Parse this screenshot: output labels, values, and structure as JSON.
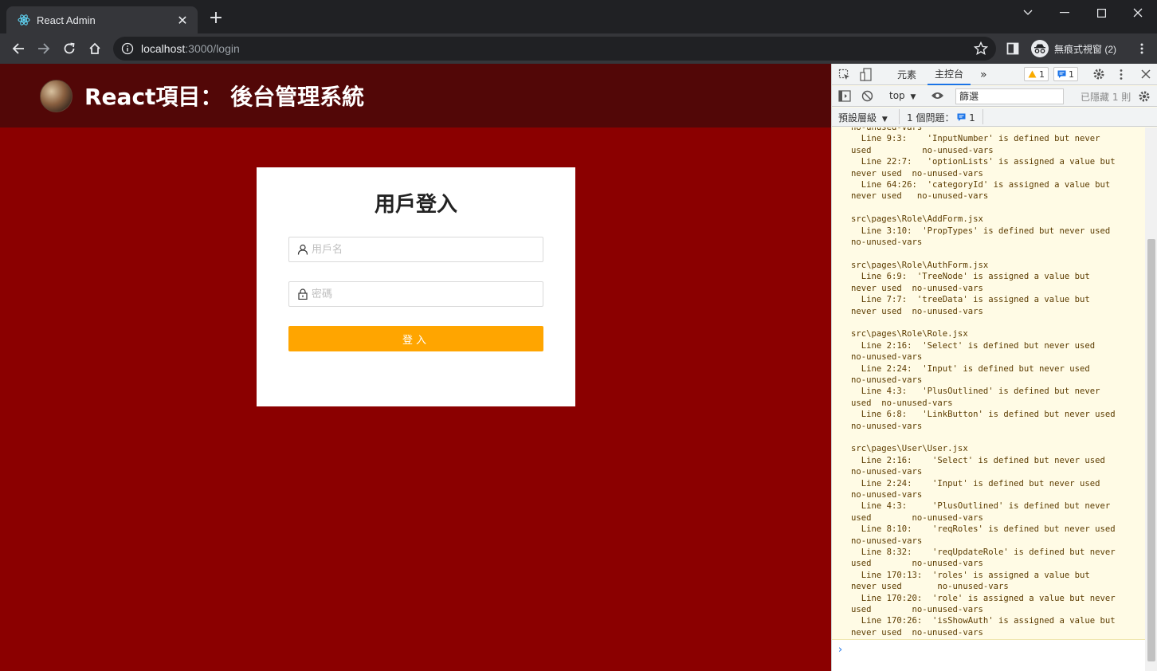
{
  "browser": {
    "tab_title": "React Admin",
    "url_host": "localhost",
    "url_path": ":3000/login",
    "incognito_label": "無痕式視窗 (2)"
  },
  "page": {
    "header_title": "React項目： 後台管理系統",
    "login": {
      "title": "用戶登入",
      "username_placeholder": "用戶名",
      "password_placeholder": "密碼",
      "submit_label": "登入"
    },
    "colors": {
      "background": "#8b0000",
      "header": "#520707",
      "button": "#ffa500"
    }
  },
  "devtools": {
    "tabs": [
      "元素",
      "主控台"
    ],
    "more_tabs": "»",
    "warning_count": "1",
    "message_count": "1",
    "context": "top",
    "filter_value": "篩選",
    "hidden_label": "已隱藏 1 則",
    "levels_label": "預設層級",
    "issues_label": "1 個問題：",
    "issues_count": "1",
    "console_text": "no-unused-vars\n  Line 9:3:    'InputNumber' is defined but never\nused          no-unused-vars\n  Line 22:7:   'optionLists' is assigned a value but\nnever used  no-unused-vars\n  Line 64:26:  'categoryId' is assigned a value but\nnever used   no-unused-vars\n\nsrc\\pages\\Role\\AddForm.jsx\n  Line 3:10:  'PropTypes' is defined but never used\nno-unused-vars\n\nsrc\\pages\\Role\\AuthForm.jsx\n  Line 6:9:  'TreeNode' is assigned a value but\nnever used  no-unused-vars\n  Line 7:7:  'treeData' is assigned a value but\nnever used  no-unused-vars\n\nsrc\\pages\\Role\\Role.jsx\n  Line 2:16:  'Select' is defined but never used\nno-unused-vars\n  Line 2:24:  'Input' is defined but never used\nno-unused-vars\n  Line 4:3:   'PlusOutlined' is defined but never\nused  no-unused-vars\n  Line 6:8:   'LinkButton' is defined but never used\nno-unused-vars\n\nsrc\\pages\\User\\User.jsx\n  Line 2:16:    'Select' is defined but never used\nno-unused-vars\n  Line 2:24:    'Input' is defined but never used\nno-unused-vars\n  Line 4:3:     'PlusOutlined' is defined but never\nused        no-unused-vars\n  Line 8:10:    'reqRoles' is defined but never used\nno-unused-vars\n  Line 8:32:    'reqUpdateRole' is defined but never\nused        no-unused-vars\n  Line 170:13:  'roles' is assigned a value but\nnever used       no-unused-vars\n  Line 170:20:  'role' is assigned a value but never\nused        no-unused-vars\n  Line 170:26:  'isShowAuth' is assigned a value but\nnever used  no-unused-vars",
    "prompt_symbol": "›"
  }
}
